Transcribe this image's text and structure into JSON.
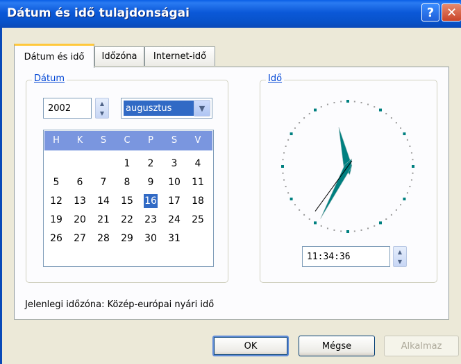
{
  "window": {
    "title": "Dátum és idő tulajdonságai",
    "help_glyph": "?",
    "close_glyph": "✕"
  },
  "tabs": [
    {
      "label": "Dátum és idő",
      "active": true
    },
    {
      "label": "Időzóna",
      "active": false
    },
    {
      "label": "Internet-idő",
      "active": false
    }
  ],
  "date_group": {
    "label": "Dátum",
    "year": "2002",
    "month": "augusztus",
    "day_headers": [
      "H",
      "K",
      "S",
      "C",
      "P",
      "S",
      "V"
    ],
    "weeks": [
      [
        "",
        "",
        "",
        "1",
        "2",
        "3",
        "4"
      ],
      [
        "5",
        "6",
        "7",
        "8",
        "9",
        "10",
        "11"
      ],
      [
        "12",
        "13",
        "14",
        "15",
        "16",
        "17",
        "18"
      ],
      [
        "19",
        "20",
        "21",
        "22",
        "23",
        "24",
        "25"
      ],
      [
        "26",
        "27",
        "28",
        "29",
        "30",
        "31",
        ""
      ]
    ],
    "selected_day": "16"
  },
  "time_group": {
    "label": "Idő",
    "time_value": "11:34:36",
    "clock": {
      "hours": 11,
      "minutes": 34,
      "seconds": 36
    }
  },
  "timezone_text": "Jelenlegi időzóna: Közép-európai nyári idő",
  "buttons": {
    "ok": "OK",
    "cancel": "Mégse",
    "apply": "Alkalmaz"
  },
  "colors": {
    "titlebar": "#0A5FE6",
    "selection": "#316AC5",
    "calendar_header": "#7A96DF",
    "group_label": "#0046D5",
    "clock_marks": "#008080"
  },
  "icons": {
    "spin_up": "▲",
    "spin_down": "▼",
    "dropdown": "▼"
  }
}
